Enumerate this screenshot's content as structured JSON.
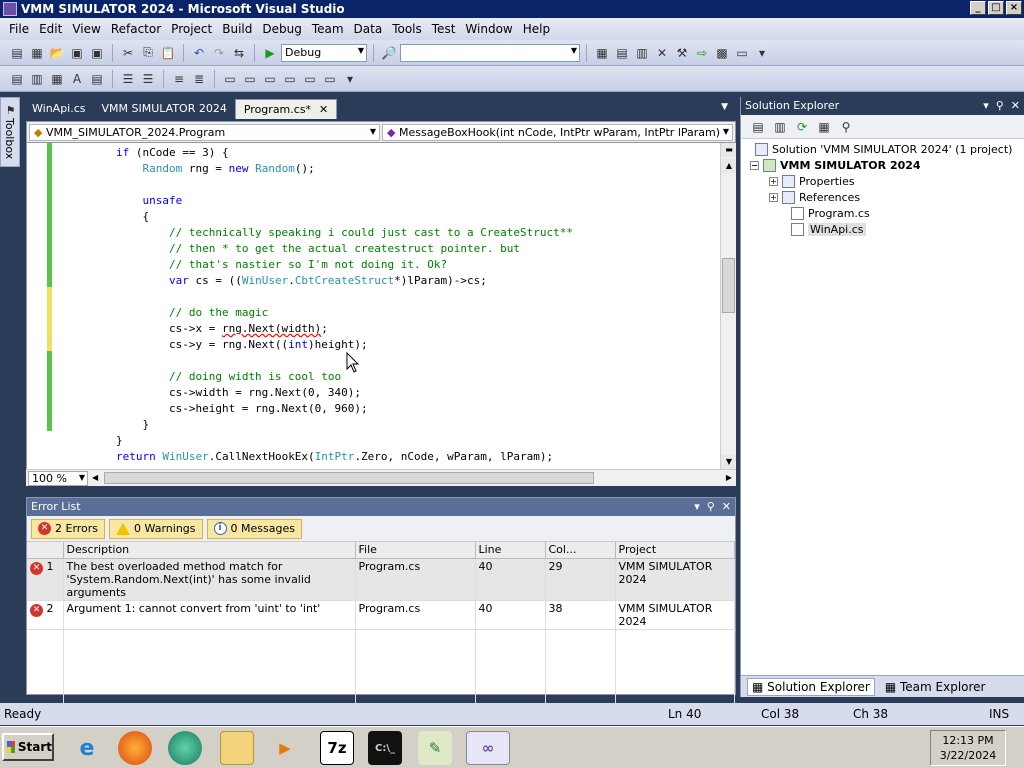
{
  "window": {
    "title": "VMM SIMULATOR 2024 - Microsoft Visual Studio",
    "controls": [
      "_",
      "□",
      "×"
    ]
  },
  "menu": [
    "File",
    "Edit",
    "View",
    "Refactor",
    "Project",
    "Build",
    "Debug",
    "Team",
    "Data",
    "Tools",
    "Test",
    "Window",
    "Help"
  ],
  "toolbar": {
    "config": "Debug",
    "platform": ""
  },
  "toolbox": {
    "label": "Toolbox"
  },
  "tabs": [
    {
      "label": "WinApi.cs",
      "active": false
    },
    {
      "label": "VMM SIMULATOR 2024",
      "active": false
    },
    {
      "label": "Program.cs*",
      "active": true
    }
  ],
  "nav": {
    "type": "VMM_SIMULATOR_2024.Program",
    "member": "MessageBoxHook(int nCode, IntPtr wParam, IntPtr lParam)"
  },
  "editor": {
    "zoom": "100 %"
  },
  "errorlist": {
    "title": "Error List",
    "filters": {
      "errors": "2 Errors",
      "warnings": "0 Warnings",
      "messages": "0 Messages"
    },
    "columns": [
      "",
      "Description",
      "File",
      "Line",
      "Col...",
      "Project"
    ],
    "rows": [
      {
        "num": "1",
        "desc1": "The best overloaded method match for",
        "desc2": "'System.Random.Next(int)' has some invalid arguments",
        "file": "Program.cs",
        "line": "40",
        "col": "29",
        "project": "VMM SIMULATOR 2024"
      },
      {
        "num": "2",
        "desc1": "Argument 1: cannot convert from 'uint' to 'int'",
        "desc2": "",
        "file": "Program.cs",
        "line": "40",
        "col": "38",
        "project": "VMM SIMULATOR 2024"
      }
    ]
  },
  "solution_explorer": {
    "title": "Solution Explorer",
    "tree": {
      "solution": "Solution 'VMM SIMULATOR 2024' (1 project)",
      "project": "VMM SIMULATOR 2024",
      "properties": "Properties",
      "references": "References",
      "program": "Program.cs",
      "winapi": "WinApi.cs"
    },
    "bottom_tabs": [
      "Solution Explorer",
      "Team Explorer"
    ]
  },
  "status": {
    "text": "Ready",
    "ln": "Ln 40",
    "col": "Col 38",
    "ch": "Ch 38",
    "mode": "INS"
  },
  "taskbar": {
    "start": "Start",
    "time": "12:13 PM",
    "date": "3/22/2024"
  }
}
